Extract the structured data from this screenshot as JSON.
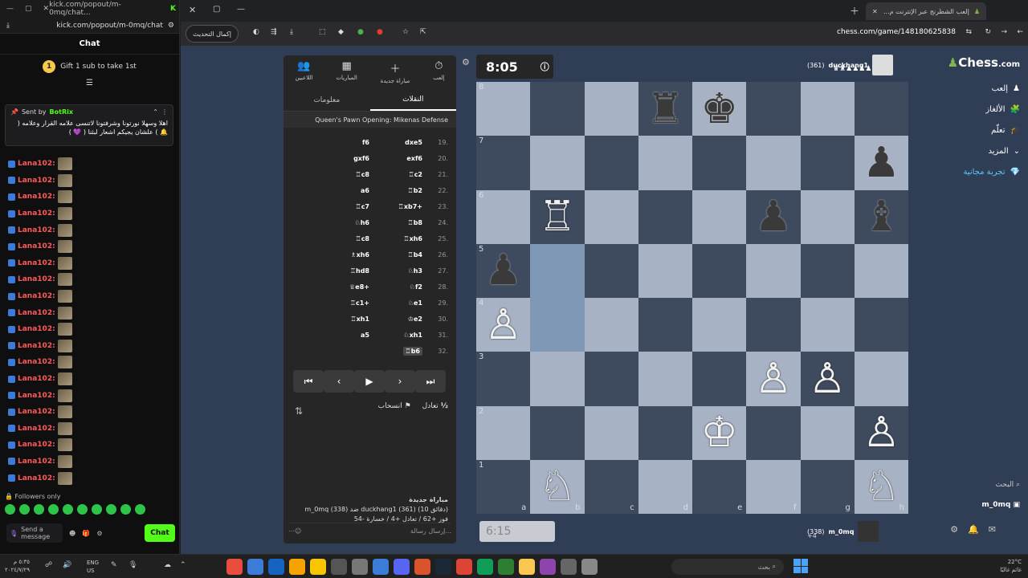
{
  "kick": {
    "url": "kick.com/popout/m-0mq/chat",
    "title": "kick.com/popout/m-0mq/chat...",
    "chat_label": "Chat",
    "gift_number": "1",
    "gift_text": "Gift 1 sub to take 1st",
    "pinned_sent_by": "Sent by",
    "pinned_user": "BotRix",
    "pinned_message": "اهلا وسهلا نورتونا وشرفتونا لاتنسى علامه القرار وعلامه ( 🔔 ) علشان يجيكم اشعار لبثنا ( 💜 )",
    "chat_user": "Lana102:",
    "chat_lines": 20,
    "followers_only": "Followers only",
    "send_placeholder": "Send a message",
    "chat_button": "Chat"
  },
  "browser": {
    "tab_title": "إلعب الشطرنج عبر الإنترنت م...",
    "update_button": "إكمال التحديث",
    "url": "chess.com/game/148180625838"
  },
  "panel": {
    "top_buttons": [
      {
        "label": "إلعب",
        "icon": "⏱"
      },
      {
        "label": "مباراة جديدة",
        "icon": "＋"
      },
      {
        "label": "المباريات",
        "icon": "▦"
      },
      {
        "label": "اللاعبين",
        "icon": "👥"
      }
    ],
    "tab_moves": "النقلات",
    "tab_info": "معلومات",
    "opening": "Queen's Pawn Opening: Mikenas Defense",
    "moves": [
      {
        "no": "19.",
        "w": "dxe5",
        "b": "f6"
      },
      {
        "no": "20.",
        "w": "exf6",
        "b": "gxf6"
      },
      {
        "no": "21.",
        "w": "♖c2",
        "b": "♖c8"
      },
      {
        "no": "22.",
        "w": "♖b2",
        "b": "a6"
      },
      {
        "no": "23.",
        "w": "♖xb7+",
        "b": "♖c7"
      },
      {
        "no": "24.",
        "w": "♖b8",
        "b": "♘h6"
      },
      {
        "no": "25.",
        "w": "♖xh6",
        "b": "♖c8"
      },
      {
        "no": "26.",
        "w": "♖b4",
        "b": "♗xh6"
      },
      {
        "no": "27.",
        "w": "♘h3",
        "b": "♖hd8"
      },
      {
        "no": "28.",
        "w": "♘f2",
        "b": "♕e8+"
      },
      {
        "no": "29.",
        "w": "♘e1",
        "b": "♖c1+"
      },
      {
        "no": "30.",
        "w": "♔e2",
        "b": "♖xh1"
      },
      {
        "no": "31.",
        "w": "♘xh1",
        "b": "a5"
      },
      {
        "no": "32.",
        "w": "♖b6",
        "b": ""
      }
    ],
    "draw": "تعادل",
    "resign": "انسحاب",
    "half": "½",
    "game_title": "مباراة جديدة",
    "game_line1": "m_0mq (338) ضد duckhang1 (361) (10 دقائق)",
    "game_line2": "فوز +62 / تعادل +4 / خسارة -54",
    "message_placeholder": "إرسال رسالة..."
  },
  "board": {
    "top_clock": "8:05",
    "bottom_clock": "6:15",
    "top_player": "duckhang1",
    "top_rating": "(361)",
    "bottom_player": "m_0mq",
    "bottom_rating": "(338)",
    "bottom_score": "+4",
    "ranks": [
      "8",
      "7",
      "6",
      "5",
      "4",
      "3",
      "2",
      "1"
    ],
    "files": [
      "a",
      "b",
      "c",
      "d",
      "e",
      "f",
      "g",
      "h"
    ],
    "pieces": {
      "d8": "♜",
      "e8": "♚",
      "h7": "♟",
      "b6": "♖",
      "f6": "♟",
      "h6": "♝",
      "a5": "♟",
      "a4": "♙",
      "f3": "♙",
      "g3": "♙",
      "e2": "♔",
      "h2": "♙",
      "b1": "♘",
      "h1": "♘"
    },
    "highlight": [
      "b4",
      "b5"
    ]
  },
  "sidebar": {
    "logo_a": "Chess",
    "logo_b": ".com",
    "items": [
      "إلعب",
      "الألغاز",
      "تعلّم",
      "المزيد",
      "تجربة مجانية"
    ],
    "search": "البحث",
    "user": "m_0mq"
  },
  "taskbar": {
    "time": "٥:٣٥ م",
    "date": "٢٠٢٤/٧/٢٩",
    "lang1": "ENG",
    "lang2": "US",
    "search": "بحث",
    "temp": "22°C",
    "weather": "غائم غالبًا"
  }
}
